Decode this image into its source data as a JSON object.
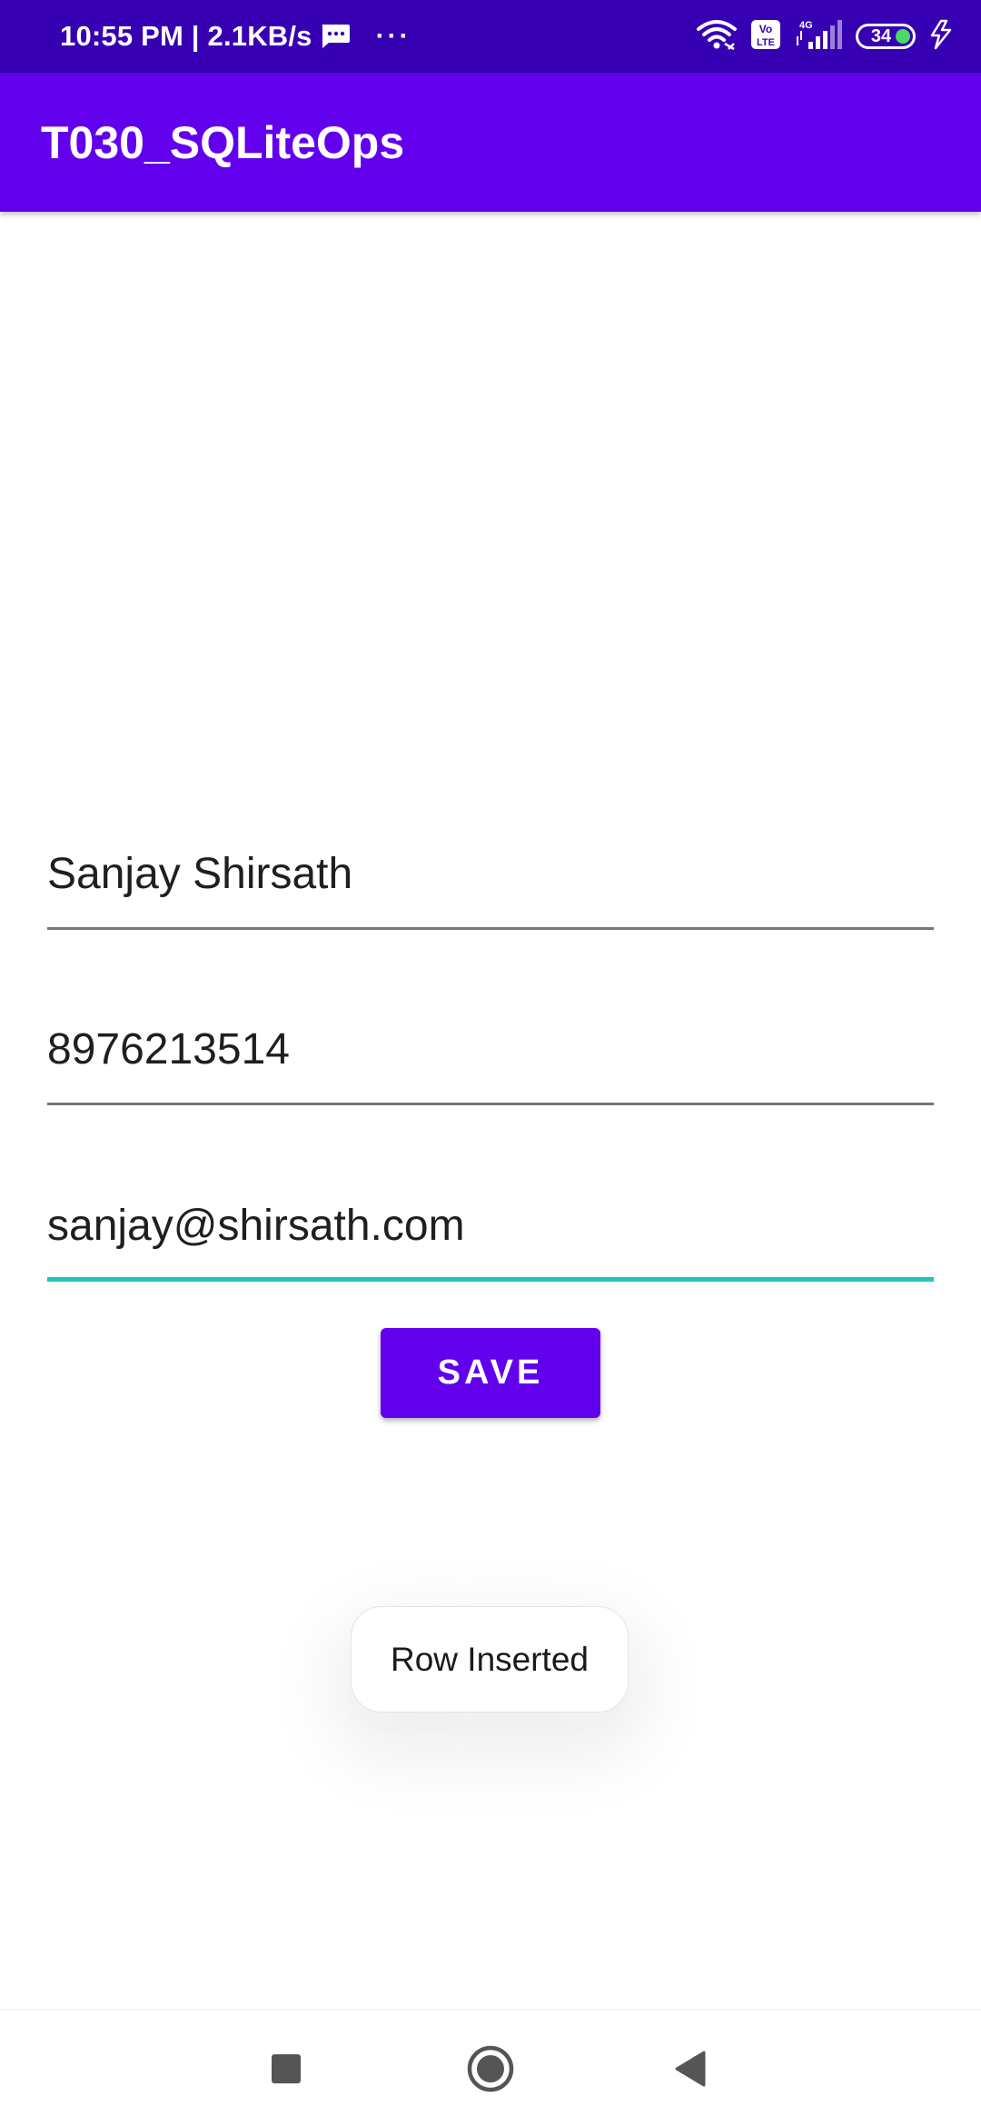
{
  "status_bar": {
    "time_speed": "10:55 PM | 2.1KB/s",
    "more": "···",
    "volte": "Vo LTE",
    "network": "4G",
    "battery": "34",
    "icons": [
      "wifi-icon",
      "volte-icon",
      "signal-4g-icon",
      "battery-icon",
      "charging-icon",
      "message-icon"
    ]
  },
  "app_bar": {
    "title": "T030_SQLiteOps"
  },
  "form": {
    "name_value": "Sanjay Shirsath",
    "phone_value": "8976213514",
    "email_value": "sanjay@shirsath.com",
    "save_label": "SAVE"
  },
  "toast": {
    "message": "Row Inserted"
  },
  "nav_bar": {
    "icons": [
      "recents-icon",
      "home-icon",
      "back-icon"
    ]
  },
  "colors": {
    "status_bar": "#3700b3",
    "primary": "#6200ee",
    "focus_underline": "#20c5b8",
    "underline": "#757575",
    "battery_fill": "#4cd964"
  }
}
